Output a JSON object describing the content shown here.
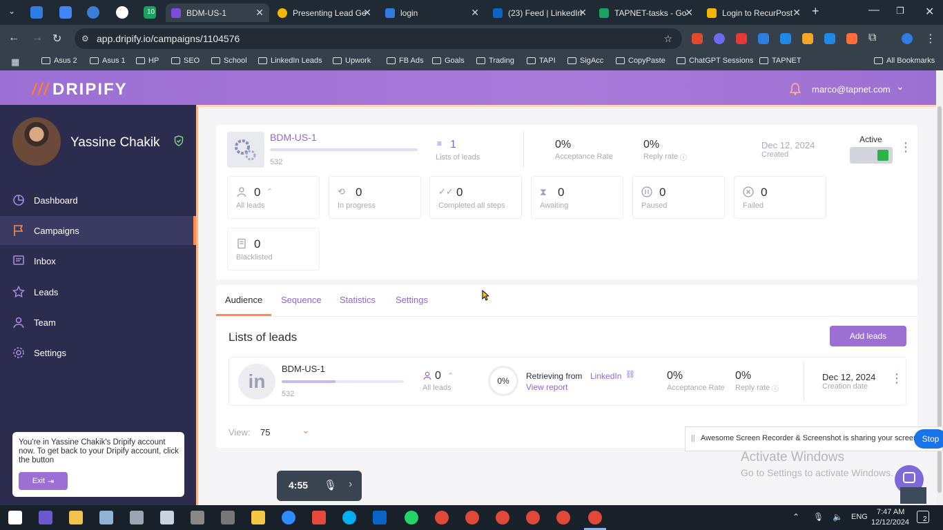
{
  "browser": {
    "tabs": [
      {
        "title": "BDM-US-1",
        "color": "#7c4ddb"
      },
      {
        "title": "Presenting Lead Ge",
        "color": "#f5b400"
      },
      {
        "title": "login",
        "color": "#2f7de1"
      },
      {
        "title": "(23) Feed | LinkedIn",
        "color": "#0a66c2"
      },
      {
        "title": "TAPNET-tasks - Go",
        "color": "#1aa260"
      },
      {
        "title": "Login to RecurPost",
        "color": "#f5b400"
      }
    ],
    "pinned_count": "10",
    "url": "app.dripify.io/campaigns/1104576",
    "bookmarks": [
      "Asus 2",
      "Asus 1",
      "HP",
      "SEO",
      "School",
      "LinkedIn Leads",
      "Upwork",
      "FB Ads",
      "Goals",
      "Trading",
      "TAPI",
      "SigAcc",
      "CopyPaste",
      "ChatGPT Sessions",
      "TAPNET"
    ],
    "all_bookmarks": "All Bookmarks"
  },
  "header": {
    "logo": "DRIPIFY",
    "user_email": "marco@tapnet.com"
  },
  "sidebar": {
    "profile_name": "Yassine Chakik",
    "items": [
      {
        "label": "Dashboard"
      },
      {
        "label": "Campaigns"
      },
      {
        "label": "Inbox"
      },
      {
        "label": "Leads"
      },
      {
        "label": "Team"
      },
      {
        "label": "Settings"
      }
    ],
    "notice": {
      "text": "You're in Yassine Chakik's Dripify account now. To get back to your Dripify account, click the button",
      "exit_label": "Exit"
    }
  },
  "campaign": {
    "name": "BDM-US-1",
    "count": "532",
    "lists_value": "1",
    "lists_label": "Lists of leads",
    "acceptance_value": "0%",
    "acceptance_label": "Acceptance Rate",
    "reply_value": "0%",
    "reply_label": "Reply rate",
    "created_date": "Dec 12, 2024",
    "created_label": "Created",
    "status_label": "Active",
    "stats": [
      {
        "value": "0",
        "label": "All leads"
      },
      {
        "value": "0",
        "label": "In progress"
      },
      {
        "value": "0",
        "label": "Completed all steps"
      },
      {
        "value": "0",
        "label": "Awaiting"
      },
      {
        "value": "0",
        "label": "Paused"
      },
      {
        "value": "0",
        "label": "Failed"
      },
      {
        "value": "0",
        "label": "Blacklisted"
      }
    ]
  },
  "tabs": [
    "Audience",
    "Sequence",
    "Statistics",
    "Settings"
  ],
  "lists_section": {
    "title": "Lists of leads",
    "add_button": "Add leads",
    "row": {
      "name": "BDM-US-1",
      "count": "532",
      "leads_value": "0",
      "leads_label": "All leads",
      "progress": "0%",
      "retrieving": "Retrieving from",
      "source": "LinkedIn",
      "view_report": "View report",
      "acceptance_value": "0%",
      "acceptance_label": "Acceptance Rate",
      "reply_value": "0%",
      "reply_label": "Reply rate",
      "date": "Dec 12, 2024",
      "date_label": "Creation date"
    },
    "view_label": "View:",
    "view_value": "75"
  },
  "overlays": {
    "sharing_text": "Awesome Screen Recorder & Screenshot is sharing your screen.",
    "stop_label": "Stop",
    "activate_title": "Activate Windows",
    "activate_sub": "Go to Settings to activate Windows.",
    "recorder_time": "4:55"
  },
  "taskbar": {
    "lang": "ENG",
    "time": "7:47 AM",
    "date": "12/12/2024",
    "notif_count": "2"
  },
  "colors": {
    "accent": "#9b6fd4",
    "sidebar_bg": "#2c2c4f",
    "highlight": "#ff8a4c"
  }
}
